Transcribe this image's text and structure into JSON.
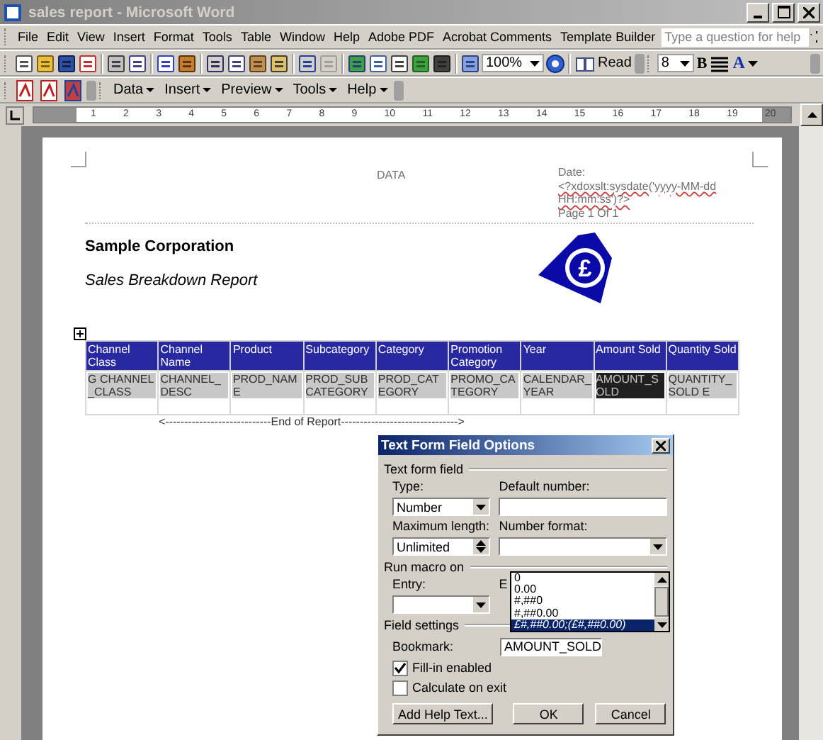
{
  "window": {
    "title": "sales report - Microsoft Word"
  },
  "menu": [
    {
      "label": "File"
    },
    {
      "label": "Edit"
    },
    {
      "label": "View"
    },
    {
      "label": "Insert"
    },
    {
      "label": "Format"
    },
    {
      "label": "Tools"
    },
    {
      "label": "Table"
    },
    {
      "label": "Window"
    },
    {
      "label": "Help"
    },
    {
      "label": "Adobe PDF"
    },
    {
      "label": "Acrobat Comments"
    },
    {
      "label": "Template Builder"
    }
  ],
  "help_search": {
    "placeholder": "Type a question for help"
  },
  "toolbar": {
    "zoom": "100%",
    "read": "Read",
    "font_size": "8",
    "bold": "B",
    "font_color": "A"
  },
  "template_toolbar": [
    "Data",
    "Insert",
    "Preview",
    "Tools",
    "Help"
  ],
  "ruler": [
    "1",
    "2",
    "3",
    "4",
    "5",
    "6",
    "7",
    "8",
    "9",
    "10",
    "11",
    "12",
    "13",
    "14",
    "15",
    "16",
    "17",
    "18",
    "19",
    "20"
  ],
  "header": {
    "center": "DATA",
    "date_label": "Date:",
    "date_field": "<?xdoxslt:sysdate('yyyy-MM-dd HH:mm:ss')?>",
    "page": "Page 1 Of 1"
  },
  "company": "Sample Corporation",
  "report_title": "Sales Breakdown Report",
  "logo": {
    "symbol": "£"
  },
  "table": {
    "columns": [
      "Channel Class",
      "Channel Name",
      "Product",
      "Subcategory",
      "Category",
      "Promotion Category",
      "Year",
      "Amount Sold",
      "Quantity Sold"
    ],
    "rows": [
      {
        "cells": [
          {
            "text": "G CHANNEL_CLASS",
            "selected": false
          },
          {
            "text": "CHANNEL_DESC",
            "selected": false
          },
          {
            "text": "PROD_NAME",
            "selected": false
          },
          {
            "text": "PROD_SUBCATEGORY",
            "selected": false
          },
          {
            "text": "PROD_CATEGORY",
            "selected": false
          },
          {
            "text": "PROMO_CATEGORY",
            "selected": false
          },
          {
            "text": "CALENDAR_YEAR",
            "selected": false
          },
          {
            "text": "AMOUNT_SOLD",
            "selected": true
          },
          {
            "text": "QUANTITY_SOLD E",
            "selected": false
          }
        ]
      }
    ]
  },
  "end_of_report": "<----------------------------End of Report------------------------------->",
  "dialog": {
    "title": "Text Form Field Options",
    "text_group": "Text form field",
    "type_label": "Type:",
    "type_value": "Number",
    "default_label": "Default number:",
    "max_label": "Maximum length:",
    "max_value": "Unlimited",
    "format_label": "Number format:",
    "format_options": [
      {
        "label": "0",
        "selected": false
      },
      {
        "label": "0.00",
        "selected": false
      },
      {
        "label": "#,##0",
        "selected": false
      },
      {
        "label": "#,##0.00",
        "selected": false
      },
      {
        "label": "£#,##0.00;(£#,##0.00)",
        "selected": true
      }
    ],
    "macro_group": "Run macro on",
    "entry_label": "Entry:",
    "exit_label": "E",
    "settings_group": "Field settings",
    "bookmark_label": "Bookmark:",
    "bookmark_value": "AMOUNT_SOLD",
    "checkboxes": [
      {
        "label": "Fill-in enabled",
        "checked": true
      },
      {
        "label": "Calculate on exit",
        "checked": false
      }
    ],
    "buttons": [
      "Add Help Text...",
      "OK",
      "Cancel"
    ]
  }
}
